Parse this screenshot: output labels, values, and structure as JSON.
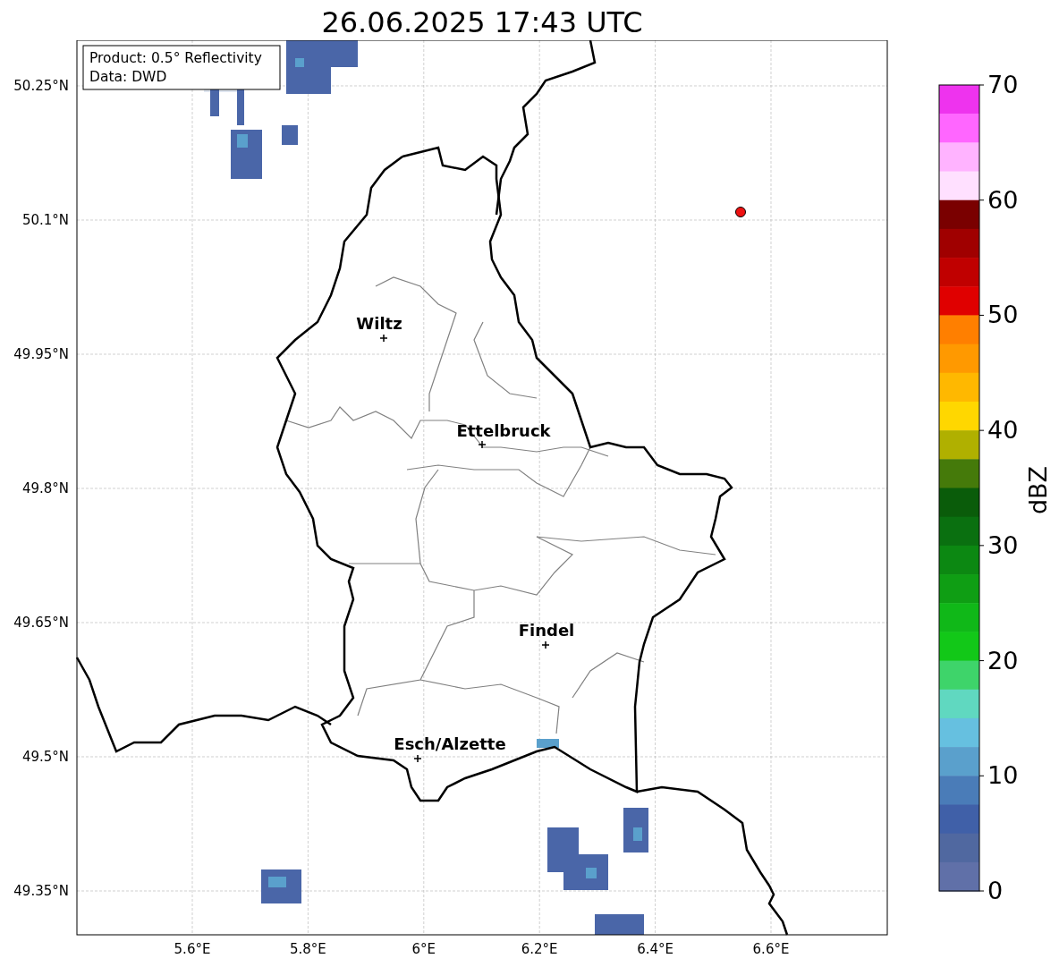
{
  "title": "26.06.2025 17:43 UTC",
  "info_box": {
    "lines": [
      "Product: 0.5° Reflectivity",
      "Data: DWD"
    ]
  },
  "map": {
    "x_ticks": [
      "5.6°E",
      "5.8°E",
      "6°E",
      "6.2°E",
      "6.4°E",
      "6.6°E"
    ],
    "y_ticks": [
      "50.25°N",
      "50.1°N",
      "49.95°N",
      "49.8°N",
      "49.65°N",
      "49.5°N",
      "49.35°N"
    ],
    "cities": [
      {
        "name": "Wiltz"
      },
      {
        "name": "Ettelbruck"
      },
      {
        "name": "Findel"
      },
      {
        "name": "Esch/Alzette"
      }
    ]
  },
  "colorbar": {
    "label": "dBZ",
    "ticks": [
      "70",
      "60",
      "50",
      "40",
      "30",
      "20",
      "10",
      "0"
    ],
    "bands": [
      {
        "color": "#ee33ee"
      },
      {
        "color": "#ff66ff"
      },
      {
        "color": "#ffb3ff"
      },
      {
        "color": "#ffe0ff"
      },
      {
        "color": "#7a0000"
      },
      {
        "color": "#a00000"
      },
      {
        "color": "#c00000"
      },
      {
        "color": "#e00000"
      },
      {
        "color": "#ff7f00"
      },
      {
        "color": "#ff9900"
      },
      {
        "color": "#ffb800"
      },
      {
        "color": "#ffd700"
      },
      {
        "color": "#b0b000"
      },
      {
        "color": "#457a0a"
      },
      {
        "color": "#0a5c0a"
      },
      {
        "color": "#0a7010"
      },
      {
        "color": "#0c8812"
      },
      {
        "color": "#0f9e14"
      },
      {
        "color": "#10b818"
      },
      {
        "color": "#12c818"
      },
      {
        "color": "#3ed46a"
      },
      {
        "color": "#60d8c0"
      },
      {
        "color": "#66c0e0"
      },
      {
        "color": "#5aa0cc"
      },
      {
        "color": "#4a7cb8"
      },
      {
        "color": "#4060a8"
      },
      {
        "color": "#5068a0"
      },
      {
        "color": "#6070a8"
      }
    ]
  }
}
